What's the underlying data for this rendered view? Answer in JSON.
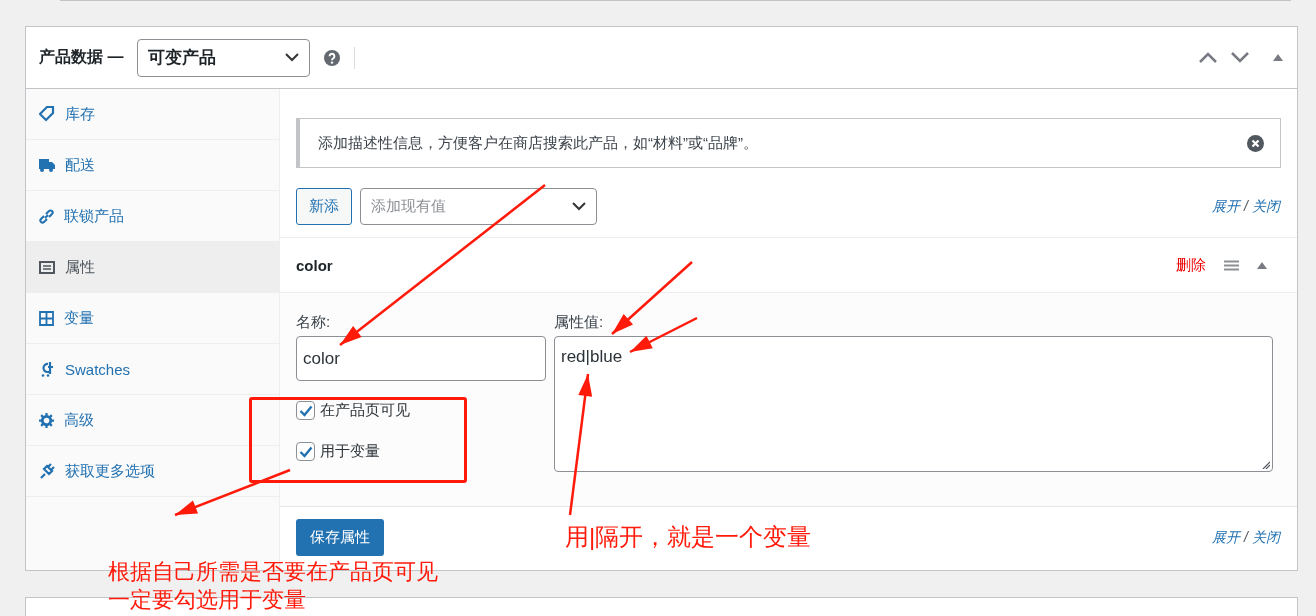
{
  "panel": {
    "title": "产品数据 —",
    "product_type": "可变产品"
  },
  "nav": [
    {
      "label": "库存",
      "selected": false
    },
    {
      "label": "配送",
      "selected": false
    },
    {
      "label": "联锁产品",
      "selected": false
    },
    {
      "label": "属性",
      "selected": true
    },
    {
      "label": "变量",
      "selected": false
    },
    {
      "label": "Swatches",
      "selected": false
    },
    {
      "label": "高级",
      "selected": false
    },
    {
      "label": "获取更多选项",
      "selected": false
    }
  ],
  "notice": "添加描述性信息，方便客户在商店搜索此产品，如“材料”或“品牌”。",
  "add_button": "新添",
  "existing_select": {
    "placeholder": "添加现有值"
  },
  "toolbar_top": {
    "expand": "展开",
    "separator": "/",
    "close": "关闭"
  },
  "attribute": {
    "heading": "color",
    "remove": "删除",
    "name_label": "名称:",
    "name_value": "color",
    "values_label": "属性值:",
    "values_value": "red|blue",
    "options": [
      {
        "label": "在产品页可见",
        "checked": true
      },
      {
        "label": "用于变量",
        "checked": true
      }
    ]
  },
  "save_button": "保存属性",
  "toolbar_bottom": {
    "expand": "展开",
    "separator": "/",
    "close": "关闭"
  },
  "annotations": {
    "left": [
      "根据自己所需是否要在产品页可见",
      "一定要勾选用于变量"
    ],
    "right": "用|隔开，就是一个变量"
  }
}
